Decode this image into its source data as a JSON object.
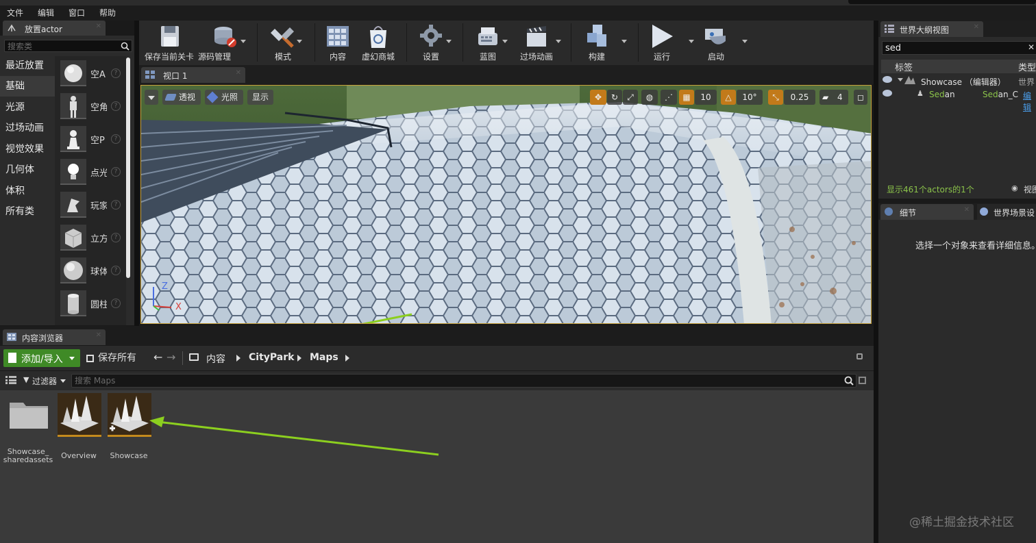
{
  "menu": [
    "文件",
    "编辑",
    "窗口",
    "帮助"
  ],
  "place_panel": {
    "tab_label": "放置actor",
    "search_placeholder": "搜索类",
    "categories": [
      {
        "label": "最近放置",
        "active": false
      },
      {
        "label": "基础",
        "active": true
      },
      {
        "label": "光源",
        "active": false
      },
      {
        "label": "过场动画",
        "active": false
      },
      {
        "label": "视觉效果",
        "active": false
      },
      {
        "label": "几何体",
        "active": false
      },
      {
        "label": "体积",
        "active": false
      },
      {
        "label": "所有类",
        "active": false
      }
    ],
    "actors": [
      {
        "label": "空A",
        "icon": "sphere-icon"
      },
      {
        "label": "空角",
        "icon": "mannequin-icon"
      },
      {
        "label": "空P",
        "icon": "pawn-icon"
      },
      {
        "label": "点光",
        "icon": "lightbulb-icon"
      },
      {
        "label": "玩家",
        "icon": "player-start-icon"
      },
      {
        "label": "立方",
        "icon": "cube-icon"
      },
      {
        "label": "球体",
        "icon": "sphere-icon"
      },
      {
        "label": "圆柱",
        "icon": "cylinder-icon"
      }
    ]
  },
  "toolbar": {
    "buttons": [
      {
        "label": "保存当前关卡",
        "icon": "save-icon"
      },
      {
        "label": "源码管理",
        "icon": "source-control-icon"
      },
      {
        "label": "模式",
        "icon": "modes-icon"
      },
      {
        "label": "内容",
        "icon": "content-icon"
      },
      {
        "label": "虚幻商城",
        "icon": "marketplace-icon"
      },
      {
        "label": "设置",
        "icon": "settings-icon"
      },
      {
        "label": "蓝图",
        "icon": "blueprint-icon"
      },
      {
        "label": "过场动画",
        "icon": "cinematics-icon"
      },
      {
        "label": "构建",
        "icon": "build-icon"
      },
      {
        "label": "运行",
        "icon": "play-icon"
      },
      {
        "label": "启动",
        "icon": "launch-icon"
      }
    ]
  },
  "viewport": {
    "tab_label": "视口 1",
    "perspective_label": "透视",
    "lit_label": "光照",
    "show_label": "显示",
    "grid_snap": "10",
    "rotation_snap": "10°",
    "scale_snap": "0.25",
    "camera_speed": "4",
    "axis_z": "Z",
    "axis_x": "X"
  },
  "content_browser": {
    "tab_label": "内容浏览器",
    "add_import_label": "添加/导入",
    "save_all_label": "保存所有",
    "breadcrumbs": [
      "内容",
      "CityPark",
      "Maps"
    ],
    "filter_label": "过滤器",
    "search_placeholder": "搜索 Maps",
    "assets": [
      {
        "label": "Showcase_\nsharedassets",
        "type": "folder"
      },
      {
        "label": "Overview",
        "type": "map"
      },
      {
        "label": "Showcase",
        "type": "map"
      }
    ]
  },
  "outliner": {
    "tab_label": "世界大纲视图",
    "search_value": "sed",
    "col_label": "标签",
    "col_type": "类型",
    "rows": [
      {
        "name": "Showcase （编辑器）",
        "type": "世界"
      },
      {
        "name_highlight": "Sed",
        "name_rest": "an",
        "type_highlight": "Sed",
        "type_rest": "an_C",
        "edit": "编辑"
      }
    ],
    "footer": "显示461个actors的1个",
    "view_options": "视图"
  },
  "details": {
    "tab_label": "细节",
    "tab2_label": "世界场景设",
    "empty_message": "选择一个对象来查看详细信息。"
  },
  "watermark": "@稀土掘金技术社区",
  "colors": {
    "accent_green": "#3f8a26",
    "highlight_green": "#8bc34a",
    "viewport_border": "#c9a23a",
    "asset_underline": "#c58a1c",
    "arrow": "#8ccf1f"
  }
}
